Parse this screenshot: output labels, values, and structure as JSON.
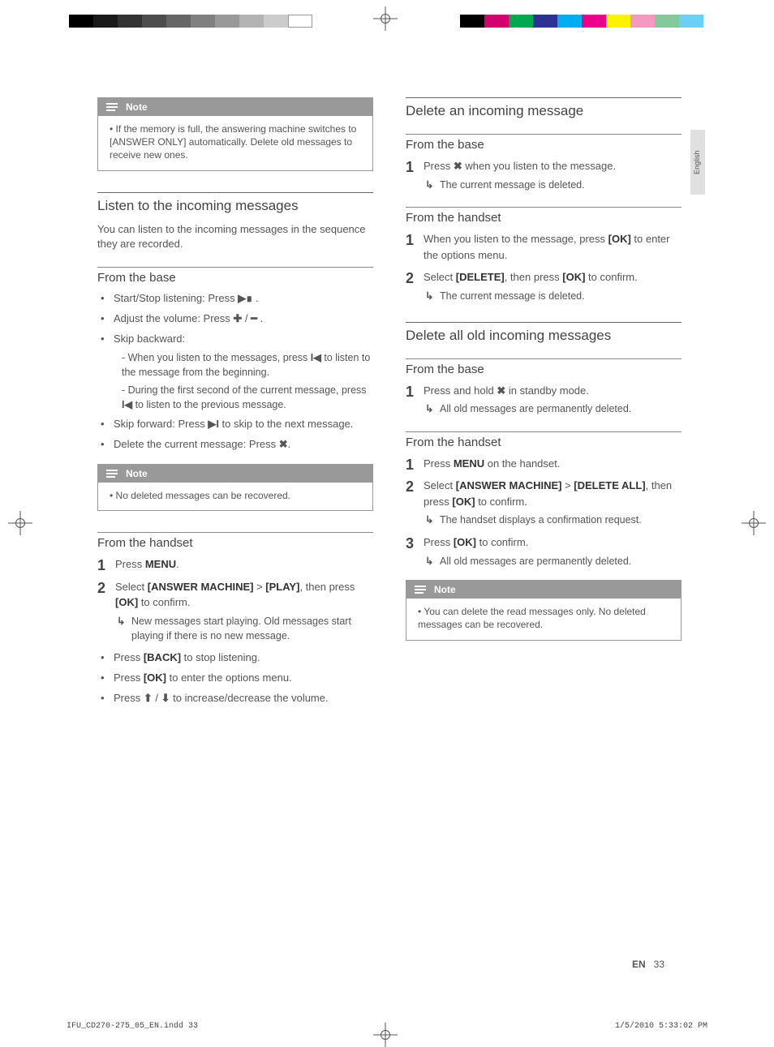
{
  "lang_tab": "English",
  "footer": {
    "lang": "EN",
    "page": "33",
    "file": "IFU_CD270-275_05_EN.indd   33",
    "date": "1/5/2010   5:33:02 PM"
  },
  "left": {
    "note1": {
      "label": "Note",
      "text": "If the memory is full, the answering machine switches to [ANSWER ONLY] automatically. Delete old messages to receive new ones."
    },
    "sec1": {
      "title": "Listen to the incoming messages",
      "intro": "You can listen to the incoming messages in the sequence they are recorded.",
      "sub1": {
        "title": "From the base",
        "b1a": "Start/Stop listening: Press ",
        "b1b": " .",
        "b2a": "Adjust the volume: Press ",
        "b2b": " / ",
        "b2c": " .",
        "b3": "Skip backward:",
        "b3s1a": "- When you listen to the messages, press ",
        "b3s1b": " to listen to the message from the beginning.",
        "b3s2a": "- During the first second of the current message, press ",
        "b3s2b": " to listen to the previous message.",
        "b4a": "Skip forward: Press ",
        "b4b": " to skip to the next message.",
        "b5a": "Delete the current message: Press ",
        "b5b": "."
      },
      "note2": {
        "label": "Note",
        "text": "No deleted messages can be recovered."
      },
      "sub2": {
        "title": "From the handset",
        "s1a": "Press ",
        "s1b": "MENU",
        "s1c": ".",
        "s2a": "Select ",
        "s2b": "[ANSWER MACHINE]",
        "s2c": " > ",
        "s2d": "[PLAY]",
        "s2e": ", then press ",
        "s2f": "[OK]",
        "s2g": " to confirm.",
        "s2r": "New messages start playing. Old messages start playing if there is no new message.",
        "b1a": "Press ",
        "b1b": "[BACK]",
        "b1c": " to stop listening.",
        "b2a": "Press ",
        "b2b": "[OK]",
        "b2c": " to enter the options menu.",
        "b3a": "Press ",
        "b3b": " / ",
        "b3c": " to increase/decrease the volume."
      }
    }
  },
  "right": {
    "sec1": {
      "title": "Delete an incoming message",
      "sub1": {
        "title": "From the base",
        "s1a": "Press ",
        "s1b": " when you listen to the message.",
        "s1r": "The current message is deleted."
      },
      "sub2": {
        "title": "From the handset",
        "s1a": "When you listen to the message, press ",
        "s1b": "[OK]",
        "s1c": " to enter the options menu.",
        "s2a": "Select ",
        "s2b": "[DELETE]",
        "s2c": ", then press ",
        "s2d": "[OK]",
        "s2e": " to confirm.",
        "s2r": "The current message is deleted."
      }
    },
    "sec2": {
      "title": "Delete all old incoming messages",
      "sub1": {
        "title": "From the base",
        "s1a": "Press and hold ",
        "s1b": " in standby mode.",
        "s1r": "All old messages are permanently deleted."
      },
      "sub2": {
        "title": "From the handset",
        "s1a": "Press ",
        "s1b": "MENU",
        "s1c": " on the handset.",
        "s2a": "Select ",
        "s2b": "[ANSWER MACHINE]",
        "s2c": " > ",
        "s2d": "[DELETE ALL]",
        "s2e": ", then press ",
        "s2f": "[OK]",
        "s2g": " to confirm.",
        "s2r": "The handset displays a confirmation request.",
        "s3a": "Press ",
        "s3b": "[OK]",
        "s3c": " to confirm.",
        "s3r": "All old messages are permanently deleted."
      },
      "note": {
        "label": "Note",
        "text": "You can delete the read messages only. No deleted messages can be recovered."
      }
    }
  }
}
